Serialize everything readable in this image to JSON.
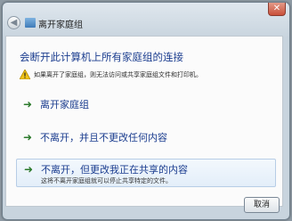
{
  "window": {
    "title": "离开家庭组",
    "close_glyph": "✕",
    "back_glyph": "◀"
  },
  "dialog": {
    "heading": "会断开此计算机上所有家庭组的连接",
    "warning": "如果离开了家庭组，则无法访问或共享家庭组文件和打印机。",
    "options": [
      {
        "label": "离开家庭组",
        "description": ""
      },
      {
        "label": "不离开，并且不更改任何内容",
        "description": ""
      },
      {
        "label": "不离开，但更改我正在共享的内容",
        "description": "这将不离开家庭组就可以停止共享特定的文件。"
      }
    ],
    "cancel_label": "取消"
  },
  "colors": {
    "heading": "#1b3d8f",
    "arrow": "#2c7a2c",
    "close": "#c9503a"
  },
  "icons": [
    "back-icon",
    "homegroup-icon",
    "warning-icon",
    "arrow-right-icon",
    "close-icon"
  ]
}
